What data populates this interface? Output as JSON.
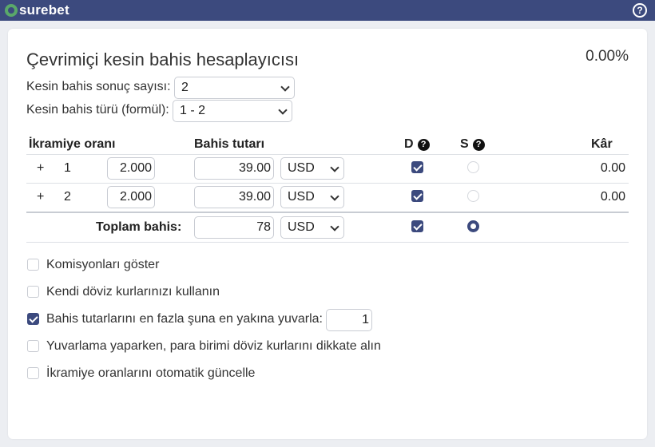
{
  "app": {
    "logo_text": "surebet"
  },
  "header": {
    "title": "Çevrimiçi kesin bahis hesaplayıcısı",
    "profit_pct": "0.00%"
  },
  "settings": {
    "outcomes_label": "Kesin bahis sonuç sayısı:",
    "outcomes_value": "2",
    "formula_label": "Kesin bahis türü (formül):",
    "formula_value": "1 - 2"
  },
  "table": {
    "headers": {
      "odds": "İkramiye oranı",
      "stake": "Bahis tutarı",
      "d": "D",
      "s": "S",
      "profit": "Kâr"
    },
    "rows": [
      {
        "plus": "+",
        "index": "1",
        "odds": "2.000",
        "stake": "39.00",
        "currency": "USD",
        "d_checked": true,
        "s_selected": false,
        "profit": "0.00"
      },
      {
        "plus": "+",
        "index": "2",
        "odds": "2.000",
        "stake": "39.00",
        "currency": "USD",
        "d_checked": true,
        "s_selected": false,
        "profit": "0.00"
      }
    ],
    "total": {
      "label": "Toplam bahis:",
      "stake": "78",
      "currency": "USD",
      "d_checked": true,
      "s_selected": true
    }
  },
  "options": [
    {
      "label": "Komisyonları göster",
      "checked": false
    },
    {
      "label": "Kendi döviz kurlarınızı kullanın",
      "checked": false
    },
    {
      "label": "Bahis tutarlarını en fazla şuna en yakına yuvarla:",
      "checked": true,
      "value": "1"
    },
    {
      "label": "Yuvarlama yaparken, para birimi döviz kurlarını dikkate alın",
      "checked": false
    },
    {
      "label": "İkramiye oranlarını otomatik güncelle",
      "checked": false
    }
  ],
  "icons": {
    "help": "question-circle-icon",
    "logo": "surebet-logo-icon",
    "dropdown": "chevron-down-icon"
  },
  "colors": {
    "topbar": "#3c4a7e",
    "accent": "#3c4a7e",
    "logo_green": "#5aa86a"
  }
}
